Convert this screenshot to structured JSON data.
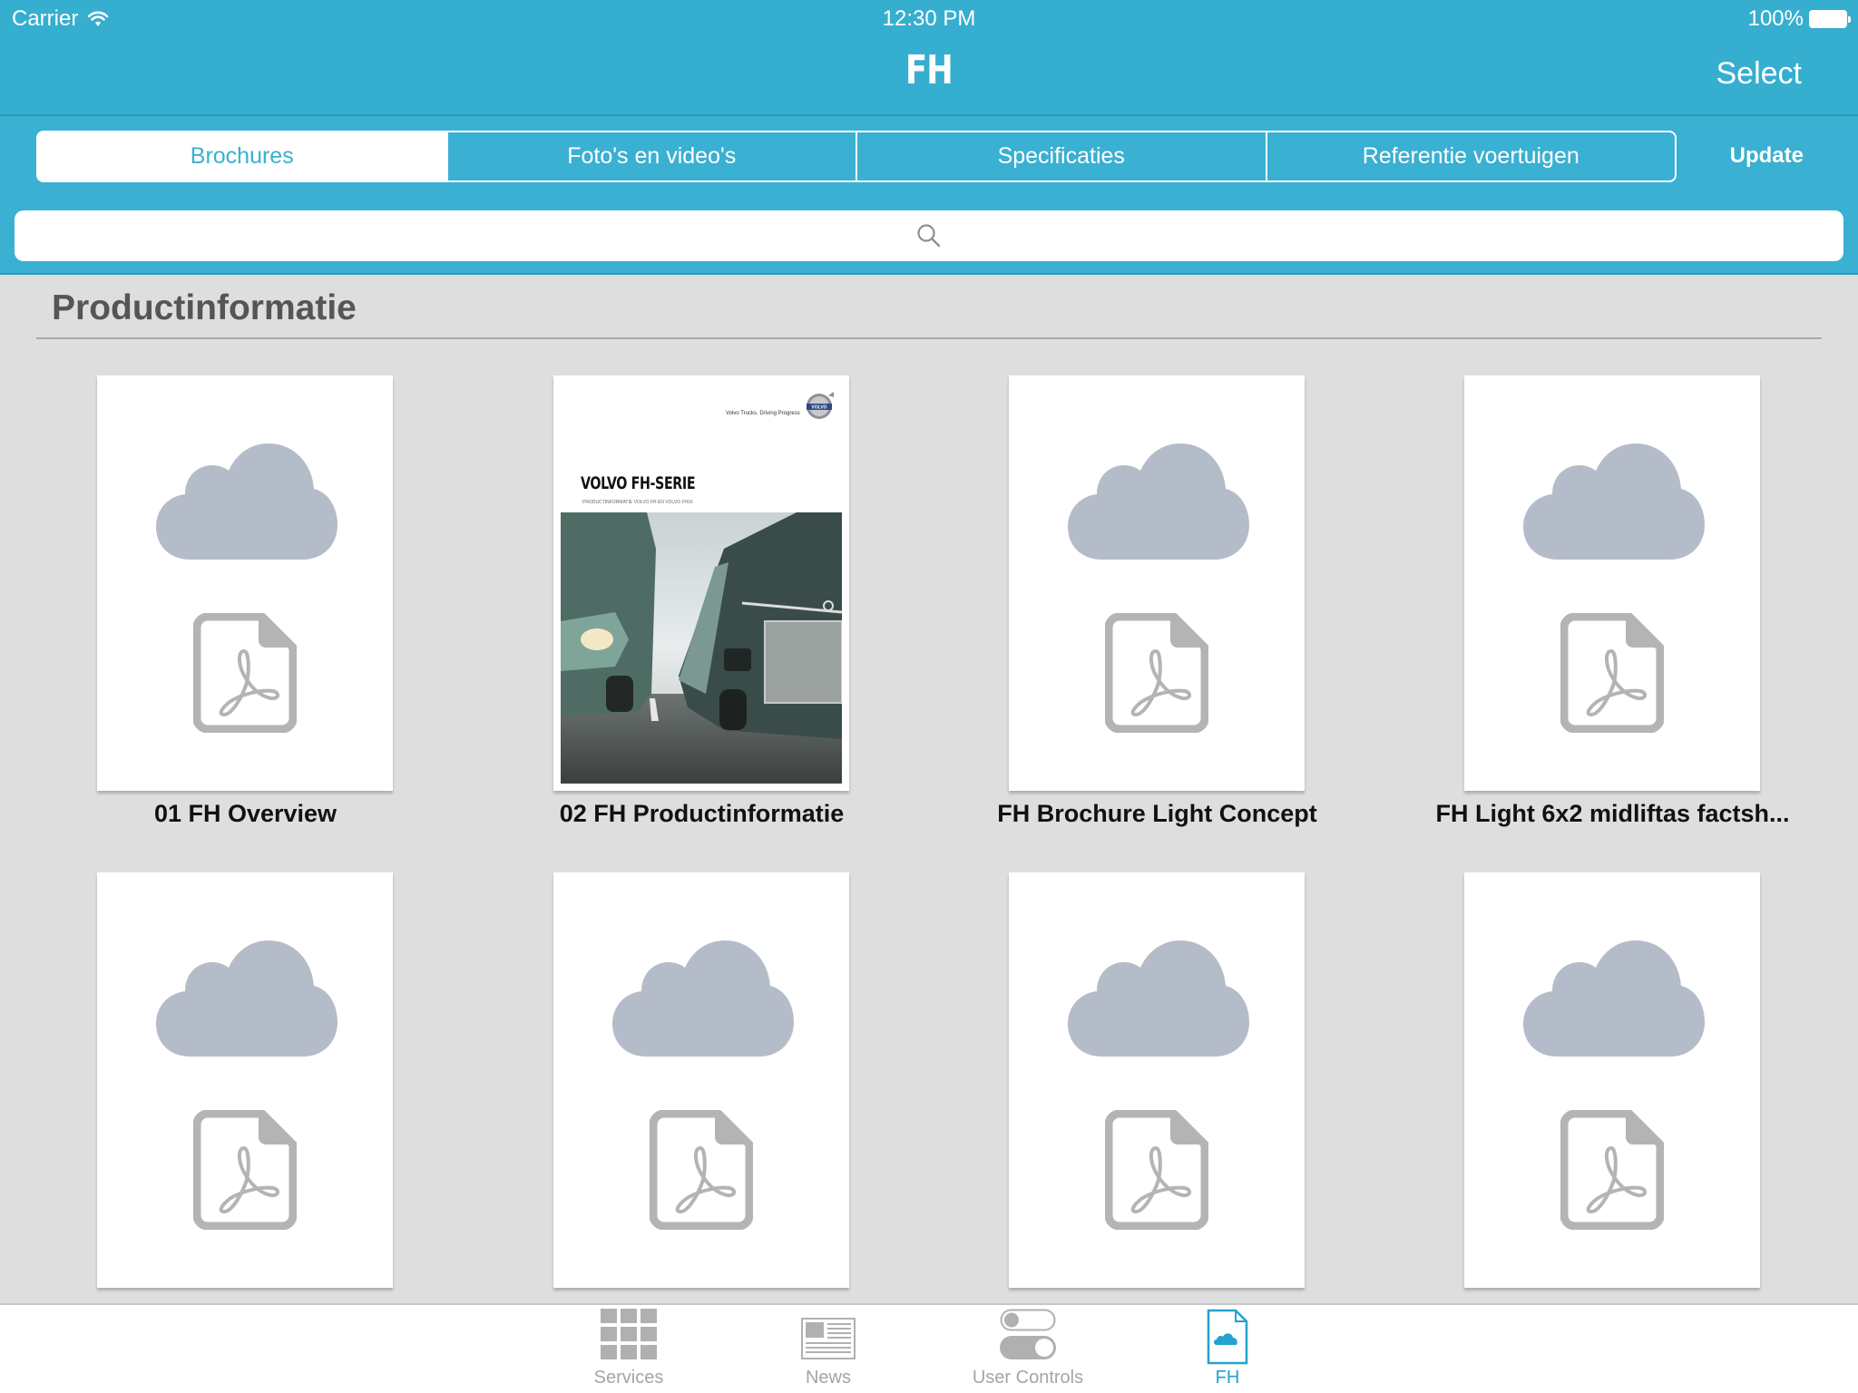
{
  "status_bar": {
    "carrier": "Carrier",
    "time": "12:30 PM",
    "battery": "100%"
  },
  "nav": {
    "title": "FH",
    "select_label": "Select"
  },
  "segments": {
    "items": [
      {
        "label": "Brochures",
        "active": true
      },
      {
        "label": "Foto's en video's",
        "active": false
      },
      {
        "label": "Specificaties",
        "active": false
      },
      {
        "label": "Referentie voertuigen",
        "active": false
      }
    ],
    "update_label": "Update"
  },
  "search": {
    "placeholder": ""
  },
  "section": {
    "title": "Productinformatie"
  },
  "documents": [
    {
      "title": "01 FH Overview",
      "thumbnail": "cloud-pdf-placeholder"
    },
    {
      "title": "02 FH Productinformatie",
      "thumbnail": "brochure-cover",
      "cover": {
        "tagline": "Volvo Trucks. Driving Progress",
        "logo_text": "VOLVO",
        "heading": "VOLVO FH-SERIE",
        "subheading": "PRODUCTINFORMATIE VOLVO FH EN VOLVO FH16"
      }
    },
    {
      "title": "FH Brochure Light Concept",
      "thumbnail": "cloud-pdf-placeholder"
    },
    {
      "title": "FH Light 6x2 midliftas factsh...",
      "thumbnail": "cloud-pdf-placeholder"
    },
    {
      "title": "",
      "thumbnail": "cloud-pdf-placeholder"
    },
    {
      "title": "",
      "thumbnail": "cloud-pdf-placeholder"
    },
    {
      "title": "",
      "thumbnail": "cloud-pdf-placeholder"
    },
    {
      "title": "",
      "thumbnail": "cloud-pdf-placeholder"
    }
  ],
  "tabbar": {
    "items": [
      {
        "label": "Services",
        "icon": "grid-icon",
        "active": false
      },
      {
        "label": "News",
        "icon": "newspaper-icon",
        "active": false
      },
      {
        "label": "User Controls",
        "icon": "toggles-icon",
        "active": false
      },
      {
        "label": "FH",
        "icon": "cloud-document-icon",
        "active": true
      }
    ]
  },
  "colors": {
    "accent": "#36aecf",
    "tab_active": "#23a2cf",
    "tab_inactive": "#a5a5a5",
    "placeholder_cloud": "#b5bcc9",
    "placeholder_pdf": "#b4b4b4",
    "content_bg": "#dedede"
  }
}
